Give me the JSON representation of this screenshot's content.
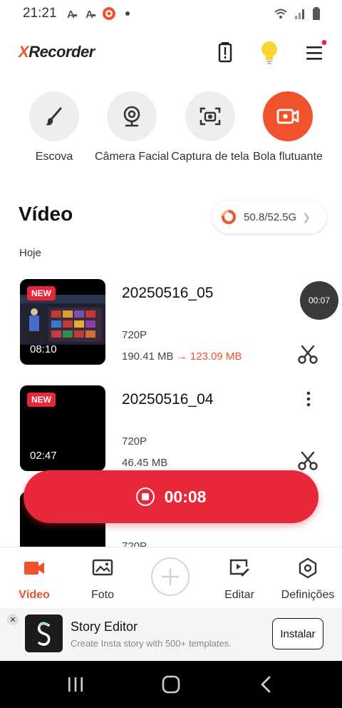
{
  "status_bar": {
    "time": "21:21",
    "icons": [
      "a-text-icon",
      "a-text-icon",
      "recorder-app-icon",
      "dot-icon",
      "wifi-icon",
      "signal-icon",
      "battery-icon"
    ]
  },
  "header": {
    "logo_x": "X",
    "logo_rest": "Recorder",
    "icons": [
      "battery-alert-icon",
      "lightbulb-icon",
      "menu-icon"
    ]
  },
  "tools": [
    {
      "label": "Escova",
      "icon": "brush-icon"
    },
    {
      "label": "Câmera Facial",
      "icon": "webcam-icon"
    },
    {
      "label": "Captura de tela",
      "icon": "screenshot-camera-icon"
    },
    {
      "label": "Bola flutuante",
      "icon": "video-recorder-icon"
    }
  ],
  "section": {
    "title": "Vídeo",
    "storage": "50.8/52.5G",
    "date_group": "Hoje"
  },
  "videos": [
    {
      "badge": "NEW",
      "duration": "08:10",
      "title": "20250516_05",
      "resolution": "720P",
      "size_original": "190.41 MB",
      "arrow": "→",
      "size_compressed": "123.09 MB"
    },
    {
      "badge": "NEW",
      "duration": "02:47",
      "title": "20250516_04",
      "resolution": "720P",
      "size_original": "46.45 MB"
    },
    {
      "resolution": "720P"
    }
  ],
  "floating_timer": "00:07",
  "recording": {
    "time": "00:08"
  },
  "bottom_nav": [
    {
      "label": "Vídeo",
      "icon": "video-camera-icon",
      "active": true
    },
    {
      "label": "Foto",
      "icon": "photo-icon",
      "active": false
    },
    {
      "label": "Editar",
      "icon": "edit-video-icon",
      "active": false
    },
    {
      "label": "Definições",
      "icon": "settings-icon",
      "active": false
    }
  ],
  "ad": {
    "close": "✕",
    "title": "Story Editor",
    "subtitle": "Create Insta story with 500+ templates.",
    "cta": "Instalar"
  },
  "colors": {
    "accent": "#f0532b",
    "record": "#e8283a"
  }
}
